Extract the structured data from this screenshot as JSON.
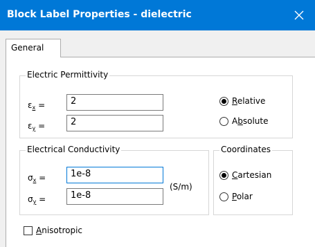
{
  "window": {
    "title": "Block Label Properties - dielectric",
    "close_symbol": "✕"
  },
  "tabs": [
    {
      "label": "General"
    }
  ],
  "permittivity": {
    "legend": "Electric Permittivity",
    "ex": {
      "symbol": "ε",
      "sub": "x",
      "eq": "=",
      "value": "2"
    },
    "ey": {
      "symbol": "ε",
      "sub": "y",
      "eq": "=",
      "value": "2"
    },
    "relative": {
      "mnemonic": "R",
      "rest": "elative",
      "checked": true
    },
    "absolute": {
      "before": "A",
      "mnemonic": "b",
      "rest": "solute",
      "checked": false
    }
  },
  "conductivity": {
    "legend": "Electrical Conductivity",
    "sx": {
      "symbol": "σ",
      "sub": "x",
      "eq": "=",
      "value": "1e-8"
    },
    "sy": {
      "symbol": "σ",
      "sub": "y",
      "eq": "=",
      "value": "1e-8"
    },
    "units": "(S/m)"
  },
  "coordinates": {
    "legend": "Coordinates",
    "cartesian": {
      "mnemonic": "C",
      "rest": "artesian",
      "checked": true
    },
    "polar": {
      "mnemonic": "P",
      "rest": "olar",
      "checked": false
    }
  },
  "anisotropic": {
    "mnemonic": "A",
    "rest": "nisotropic",
    "checked": false
  }
}
